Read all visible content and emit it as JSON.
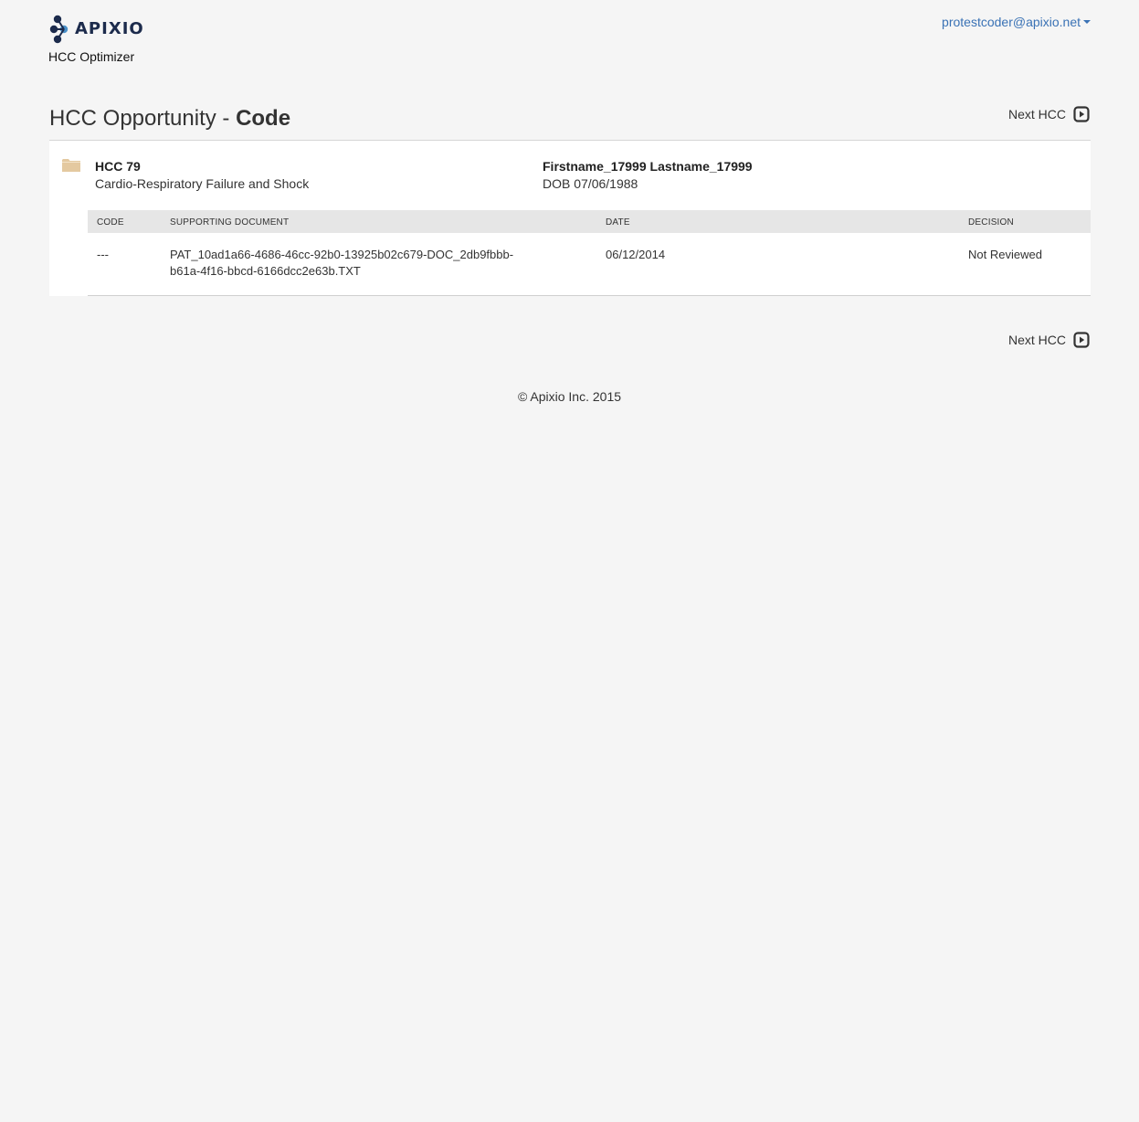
{
  "header": {
    "logo_text": "APIXIO",
    "app_name": "HCC Optimizer",
    "user_email": "protestcoder@apixio.net"
  },
  "title": {
    "prefix": "HCC Opportunity - ",
    "emphasis": "Code"
  },
  "next_label": "Next HCC",
  "opportunity": {
    "hcc": "HCC 79",
    "description": "Cardio-Respiratory Failure and Shock",
    "patient_name": "Firstname_17999 Lastname_17999",
    "dob": "DOB 07/06/1988"
  },
  "table": {
    "headers": {
      "code": "Code",
      "document": "Supporting Document",
      "date": "Date",
      "decision": "Decision"
    },
    "rows": [
      {
        "code": "---",
        "document": "PAT_10ad1a66-4686-46cc-92b0-13925b02c679-DOC_2db9fbbb-b61a-4f16-bbcd-6166dcc2e63b.TXT",
        "date": "06/12/2014",
        "decision": "Not Reviewed"
      }
    ]
  },
  "footer": "© Apixio Inc. 2015",
  "icons": {
    "logo": "apixio-logo-icon",
    "caret": "caret-down-icon",
    "next": "play-square-icon",
    "folder": "folder-icon"
  },
  "colors": {
    "link": "#3a72b5",
    "logo_navy": "#1c2b4c",
    "logo_blue": "#4a90c8",
    "folder": "#e4c9a0",
    "table_header_bg": "#e6e6e6",
    "page_bg": "#f5f5f5"
  }
}
